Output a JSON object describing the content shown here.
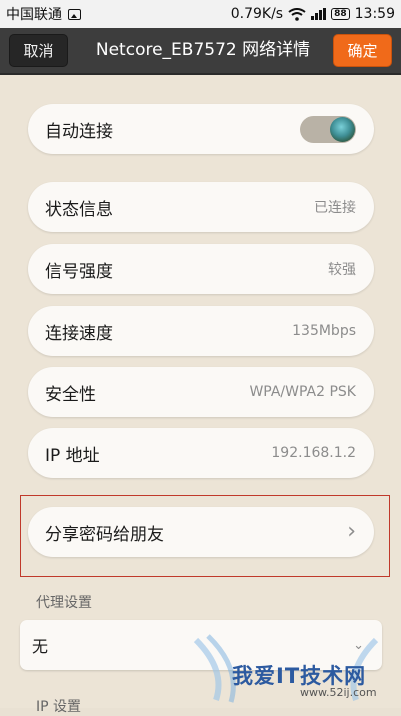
{
  "status_bar": {
    "carrier": "中国联通",
    "speed": "0.79K/s",
    "battery": "88",
    "time": "13:59"
  },
  "header": {
    "cancel_label": "取消",
    "title": "Netcore_EB7572 网络详情",
    "confirm_label": "确定"
  },
  "settings": {
    "auto_connect": {
      "label": "自动连接",
      "enabled": true
    },
    "rows": [
      {
        "label": "状态信息",
        "value": "已连接"
      },
      {
        "label": "信号强度",
        "value": "较强"
      },
      {
        "label": "连接速度",
        "value": "135Mbps"
      },
      {
        "label": "安全性",
        "value": "WPA/WPA2 PSK"
      },
      {
        "label": "IP 地址",
        "value": "192.168.1.2"
      }
    ],
    "share": {
      "label": "分享密码给朋友"
    }
  },
  "proxy": {
    "section_label": "代理设置",
    "selected": "无"
  },
  "ip_settings": {
    "section_label": "IP 设置"
  },
  "watermark": {
    "text": "我爱IT技术网",
    "url": "www.52ij.com"
  },
  "colors": {
    "accent": "#f06a1a",
    "titlebar": "#3d3d3d",
    "background": "#ece4d6",
    "highlight_border": "#c0392b"
  }
}
